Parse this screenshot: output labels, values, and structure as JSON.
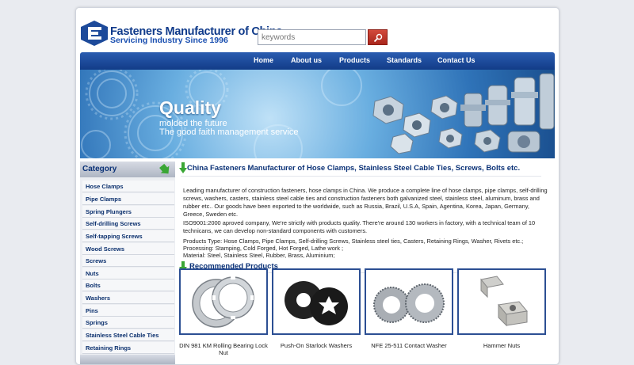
{
  "header": {
    "title": "Fasteners Manufacturer of China",
    "tagline": "Servicing Industry Since 1996",
    "search_placeholder": "keywords"
  },
  "nav": {
    "items": [
      "Home",
      "About us",
      "Products",
      "Standards",
      "Contact Us"
    ]
  },
  "banner": {
    "headline": "Quality",
    "line1": "molded the future",
    "line2": "The good faith management service"
  },
  "sidebar": {
    "title": "Category",
    "items": [
      "Hose Clamps",
      "Pipe Clamps",
      "Spring Plungers",
      "Self-drilling Screws",
      "Self-tapping Screws",
      "Wood Screws",
      "Screws",
      "Nuts",
      "Bolts",
      "Washers",
      "Pins",
      "Springs",
      "Stainless Steel Cable Ties",
      "Retaining Rings"
    ]
  },
  "main": {
    "heading": "China Fasteners Manufacturer of Hose Clamps, Stainless Steel Cable Ties, Screws, Bolts etc.",
    "para1": "Leading manufacturer of construction fasteners, hose clamps in China. We produce a complete line of hose clamps, pipe clamps, self-drilling screws, washers, casters, stainless steel cable ties and construction fasteners both galvanized steel, stainless steel, aluminum, brass and rubber etc.. Our goods have been exported to the worldwide, such as Russia, Brazil, U.S.A, Spain, Agentina, Korea, Japan, Germany, Greece, Sweden etc.",
    "para2": "ISO9001:2000 aproved company, We're strictly with products quality. There're around 130 workers in factory, with a technical team of 10 technicans, we can develop non-standard components with customers.",
    "para3_line1": "Products Type: Hose Clamps, Pipe Clamps, Self-drilling Screws, Stainless steel ties, Casters, Retaining Rings, Washer, Rivets etc.;",
    "para3_line2": "Processing: Stamping, Cold Forged, Hot Forged, Lathe work ;",
    "para3_line3": "Material: Steel, Stainless Steel, Rubber, Brass, Aluminium;",
    "recommended_title": "Recommended Products",
    "products": [
      "DIN 981 KM Rolling Bearing Lock Nut",
      "Push-On Starlock Washers",
      "NFE 25-511 Contact Washer",
      "Hammer Nuts"
    ]
  },
  "colors": {
    "nav": "#1d4a9a",
    "heading": "#0b3277",
    "accent_arrow": "#3aa635",
    "search_button": "#c0392b"
  }
}
